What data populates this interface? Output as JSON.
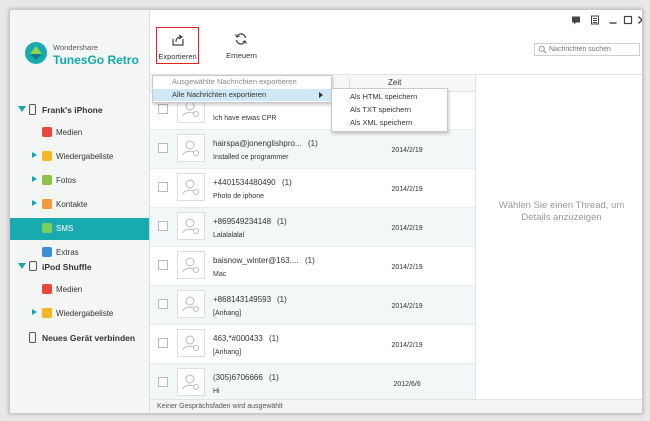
{
  "app": {
    "brand_small": "Wondershare",
    "brand_name": "TunesGo Retro"
  },
  "colors": {
    "accent": "#19aab0",
    "highlight_border": "#dd2222",
    "menu_selected": "#cfe8f5"
  },
  "sidebar": {
    "device1": {
      "label": "Frank's iPhone",
      "icon": "phone-icon"
    },
    "device1_items": [
      {
        "label": "Medien",
        "icon": "music-icon",
        "color": "#e8473e",
        "expandable": false
      },
      {
        "label": "Wiedergabeliste",
        "icon": "playlist-icon",
        "color": "#f5b622",
        "expandable": true
      },
      {
        "label": "Fotos",
        "icon": "photos-icon",
        "color": "#8bc34a",
        "expandable": true
      },
      {
        "label": "Kontakte",
        "icon": "contacts-icon",
        "color": "#f29b3a",
        "expandable": true
      },
      {
        "label": "SMS",
        "icon": "sms-icon",
        "color": "#7ccf5a",
        "expandable": false,
        "active": true
      },
      {
        "label": "Extras",
        "icon": "extras-icon",
        "color": "#3a8fd6",
        "expandable": false
      }
    ],
    "device2": {
      "label": "iPod Shuffle",
      "icon": "ipod-icon"
    },
    "device2_items": [
      {
        "label": "Medien",
        "icon": "music-icon",
        "color": "#e8473e",
        "expandable": false
      },
      {
        "label": "Wiedergabeliste",
        "icon": "playlist-icon",
        "color": "#f5b622",
        "expandable": true
      }
    ],
    "connect": {
      "label": "Neues Gerät verbinden",
      "icon": "device-connect-icon"
    }
  },
  "toolbar": {
    "export_label": "Exportieren",
    "refresh_label": "Erneuern"
  },
  "search": {
    "placeholder": "Nachrichten suchen"
  },
  "list": {
    "col_time": "Zeit"
  },
  "export_menu": {
    "items": [
      "Ausgewählte Nachrichten exportieren",
      "Alle Nachrichten exportieren"
    ],
    "submenu": [
      "Als HTML speichern",
      "Als TXT speichern",
      "Als XML speichern"
    ]
  },
  "threads": [
    {
      "name": "",
      "count": "",
      "preview": "Ich have etwas CPR",
      "date": ""
    },
    {
      "name": "hairspa@jonenglishpro...",
      "count": "(1)",
      "preview": "Installed ce programmer",
      "date": "2014/2/19"
    },
    {
      "name": "+4401534480490",
      "count": "(1)",
      "preview": "Photo de iphone",
      "date": "2014/2/19"
    },
    {
      "name": "+869549234148",
      "count": "(1)",
      "preview": "Lalalalalal",
      "date": "2014/2/19"
    },
    {
      "name": "baisnow_winter@163....",
      "count": "(1)",
      "preview": "Mac",
      "date": "2014/2/19"
    },
    {
      "name": "+868143149593",
      "count": "(1)",
      "preview": "[Anhang]",
      "date": "2014/2/19"
    },
    {
      "name": "463,*#000433",
      "count": "(1)",
      "preview": "[Anhang]",
      "date": "2014/2/19"
    },
    {
      "name": "(305)6706666",
      "count": "(1)",
      "preview": "Hi",
      "date": "2012/6/6"
    }
  ],
  "detail": {
    "empty_message": "Wählen Sie einen Thread, um Details anzuzeigen"
  },
  "status": {
    "text": "Keiner Gesprächsfaden wird ausgewählt"
  }
}
